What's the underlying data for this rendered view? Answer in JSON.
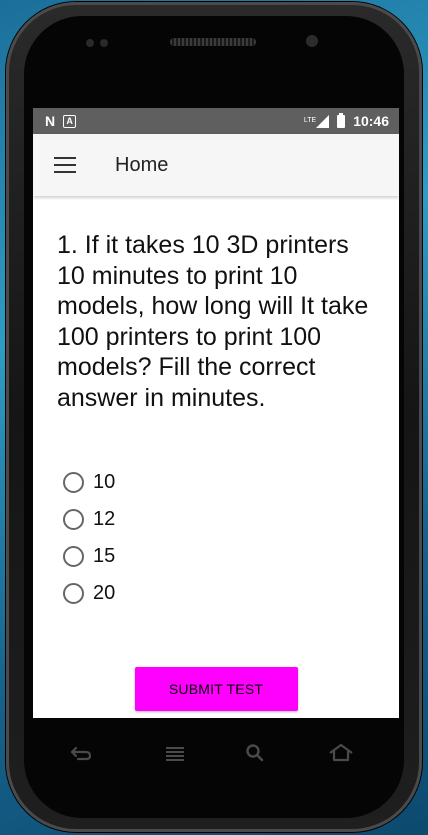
{
  "status_bar": {
    "left_icons": [
      "n-icon",
      "a-icon"
    ],
    "network": "LTE",
    "time": "10:46"
  },
  "app_bar": {
    "title": "Home"
  },
  "quiz": {
    "question": "1. If it takes 10 3D printers 10 minutes to print 10 models, how long will It take 100 printers to print 100 models? Fill the correct answer in minutes.",
    "options": [
      {
        "label": "10",
        "selected": false
      },
      {
        "label": "12",
        "selected": false
      },
      {
        "label": "15",
        "selected": false
      },
      {
        "label": "20",
        "selected": false
      }
    ],
    "submit_label": "SUBMIT TEST"
  },
  "colors": {
    "accent": "#ff00ff",
    "status_bar": "#5f5f5f",
    "app_bar": "#f6f6f6"
  },
  "nav_keys": [
    "back-icon",
    "menu-icon",
    "search-icon",
    "home-icon"
  ]
}
